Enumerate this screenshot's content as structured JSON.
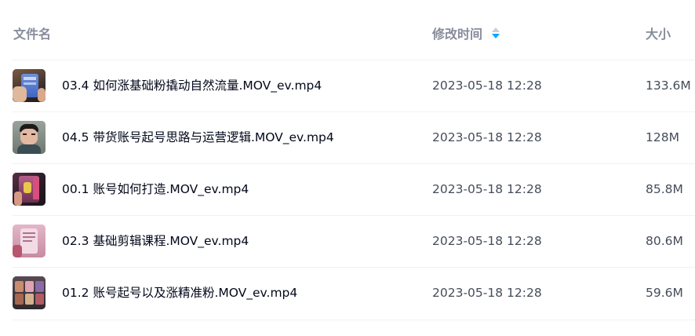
{
  "header": {
    "name_label": "文件名",
    "time_label": "修改时间",
    "size_label": "大小",
    "sort_icon": "sort-descending-icon",
    "sort_active_color": "#06a7ff"
  },
  "files": [
    {
      "name": "03.4 如何涨基础粉撬动自然流量.MOV_ev.mp4",
      "modified": "2023-05-18 12:28",
      "size": "133.6M",
      "thumbnail": "video-thumbnail-icon"
    },
    {
      "name": "04.5 带货账号起号思路与运营逻辑.MOV_ev.mp4",
      "modified": "2023-05-18 12:28",
      "size": "128M",
      "thumbnail": "video-thumbnail-icon"
    },
    {
      "name": "00.1 账号如何打造.MOV_ev.mp4",
      "modified": "2023-05-18 12:28",
      "size": "85.8M",
      "thumbnail": "video-thumbnail-icon"
    },
    {
      "name": "02.3 基础剪辑课程.MOV_ev.mp4",
      "modified": "2023-05-18 12:28",
      "size": "80.6M",
      "thumbnail": "video-thumbnail-icon"
    },
    {
      "name": "01.2 账号起号以及涨精准粉.MOV_ev.mp4",
      "modified": "2023-05-18 12:28",
      "size": "59.6M",
      "thumbnail": "video-thumbnail-icon"
    }
  ]
}
